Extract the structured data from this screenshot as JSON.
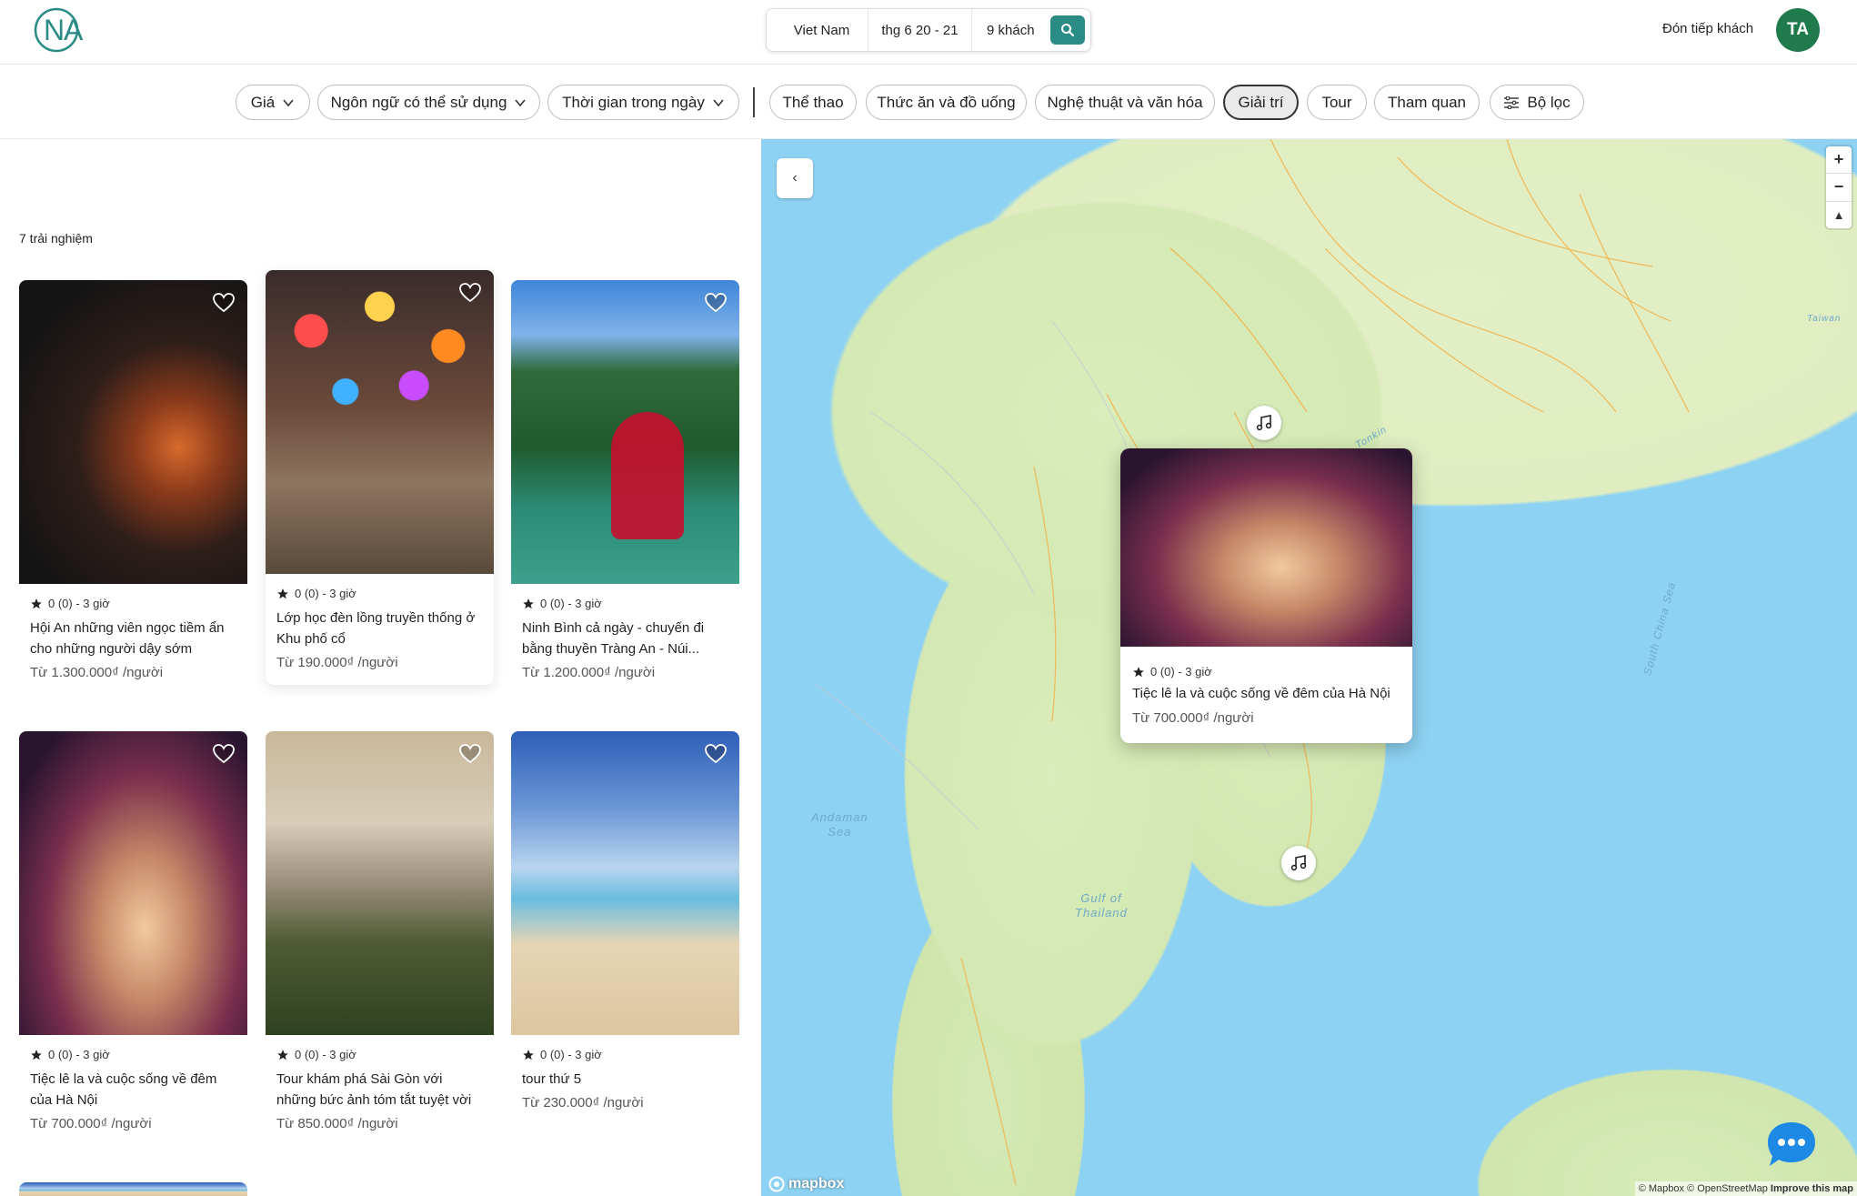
{
  "header": {
    "logo_text": "NA",
    "search": {
      "location": "Viet Nam",
      "dates": "thg 6 20 - 21",
      "guests": "9 khách"
    },
    "host_link": "Đón tiếp khách",
    "avatar_initials": "TA"
  },
  "filters": {
    "dropdowns": [
      "Giá",
      "Ngôn ngữ có thể sử dụng",
      "Thời gian trong ngày"
    ],
    "categories": [
      "Thể thao",
      "Thức ăn và đồ uống",
      "Nghệ thuật và văn hóa",
      "Giải trí",
      "Tour",
      "Tham quan"
    ],
    "active_category": "Giải trí",
    "more_filters": "Bộ lọc"
  },
  "results": {
    "count_label": "7 trải nghiệm",
    "cards": [
      {
        "rating": "0 (0) - 3 giờ",
        "title": "Hội An những viên ngọc tiềm ẩn cho những người dậy sớm",
        "price": "Từ 1.300.000₫ /người"
      },
      {
        "rating": "0 (0) - 3 giờ",
        "title": "Lớp học đèn lồng truyền thống ở Khu phố cổ",
        "price": "Từ 190.000₫ /người"
      },
      {
        "rating": "0 (0) - 3 giờ",
        "title": "Ninh Bình cả ngày - chuyến đi bằng thuyền Tràng An - Núi...",
        "price": "Từ 1.200.000₫ /người"
      },
      {
        "rating": "0 (0) - 3 giờ",
        "title": "Tiệc lê la và cuộc sống về đêm của Hà Nội",
        "price": "Từ 700.000₫ /người"
      },
      {
        "rating": "0 (0) - 3 giờ",
        "title": "Tour khám phá Sài Gòn với những bức ảnh tóm tắt tuyệt vời",
        "price": "Từ 850.000₫ /người"
      },
      {
        "rating": "0 (0) - 3 giờ",
        "title": "tour thứ 5",
        "price": "Từ 230.000₫ /người"
      }
    ]
  },
  "map": {
    "labels": {
      "taiwan": "Taiwan",
      "andaman": "Andaman\nSea",
      "gulf": "Gulf of\nThailand",
      "south_china_sea": "South China Sea",
      "gulf_tonkin": "Tonkin"
    },
    "popup": {
      "rating": "0 (0) - 3 giờ",
      "title": "Tiệc lê la và cuộc sống về đêm của Hà Nội",
      "price": "Từ 700.000₫ /người"
    },
    "controls": {
      "zoom_in": "+",
      "zoom_out": "−",
      "reset": "▲"
    },
    "collapse_icon": "‹",
    "logo": "mapbox",
    "attribution": "© Mapbox © OpenStreetMap",
    "improve": "Improve this map"
  },
  "colors": {
    "accent": "#2b8c86",
    "avatar": "#1f7a4c",
    "water": "#8ed2f3",
    "land": "#d9ecbb",
    "chat": "#1e88e5"
  }
}
